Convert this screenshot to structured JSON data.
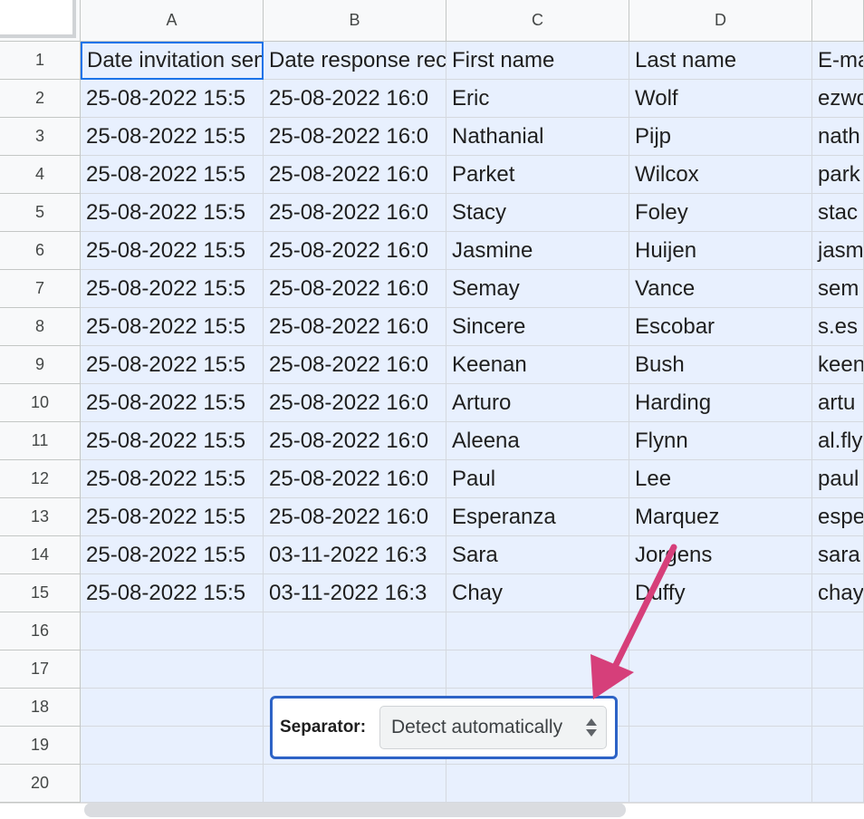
{
  "columns": [
    "A",
    "B",
    "C",
    "D",
    ""
  ],
  "row_numbers": [
    "1",
    "2",
    "3",
    "4",
    "5",
    "6",
    "7",
    "8",
    "9",
    "10",
    "11",
    "12",
    "13",
    "14",
    "15",
    "16",
    "17",
    "18",
    "19",
    "20"
  ],
  "rows": [
    [
      "Date invitation sent",
      "Date response received",
      "First name",
      "Last name",
      "E-mail"
    ],
    [
      "25-08-2022 15:5",
      "25-08-2022 16:0",
      "Eric",
      "Wolf",
      "ezwo"
    ],
    [
      "25-08-2022 15:5",
      "25-08-2022 16:0",
      "Nathanial",
      "Pijp",
      "nath"
    ],
    [
      "25-08-2022 15:5",
      "25-08-2022 16:0",
      "Parket",
      "Wilcox",
      "park"
    ],
    [
      "25-08-2022 15:5",
      "25-08-2022 16:0",
      "Stacy",
      "Foley",
      "stac"
    ],
    [
      "25-08-2022 15:5",
      "25-08-2022 16:0",
      "Jasmine",
      "Huijen",
      "jasm"
    ],
    [
      "25-08-2022 15:5",
      "25-08-2022 16:0",
      "Semay",
      "Vance",
      "sem"
    ],
    [
      "25-08-2022 15:5",
      "25-08-2022 16:0",
      "Sincere",
      "Escobar",
      "s.es"
    ],
    [
      "25-08-2022 15:5",
      "25-08-2022 16:0",
      "Keenan",
      "Bush",
      "keen"
    ],
    [
      "25-08-2022 15:5",
      "25-08-2022 16:0",
      "Arturo",
      "Harding",
      "artu"
    ],
    [
      "25-08-2022 15:5",
      "25-08-2022 16:0",
      "Aleena",
      "Flynn",
      "al.fly"
    ],
    [
      "25-08-2022 15:5",
      "25-08-2022 16:0",
      "Paul",
      "Lee",
      "paul"
    ],
    [
      "25-08-2022 15:5",
      "25-08-2022 16:0",
      "Esperanza",
      "Marquez",
      "espe"
    ],
    [
      "25-08-2022 15:5",
      "03-11-2022 16:3",
      "Sara",
      "Jorgens",
      "sara"
    ],
    [
      "25-08-2022 15:5",
      "03-11-2022 16:3",
      "Chay",
      "Duffy",
      "chay"
    ]
  ],
  "separator": {
    "label": "Separator:",
    "selected": "Detect automatically",
    "icon": "updown-arrows-icon"
  },
  "colors": {
    "selection_fill": "#e8f0fe",
    "active_border": "#1a73e8",
    "annotation_arrow": "#d63f7a"
  }
}
